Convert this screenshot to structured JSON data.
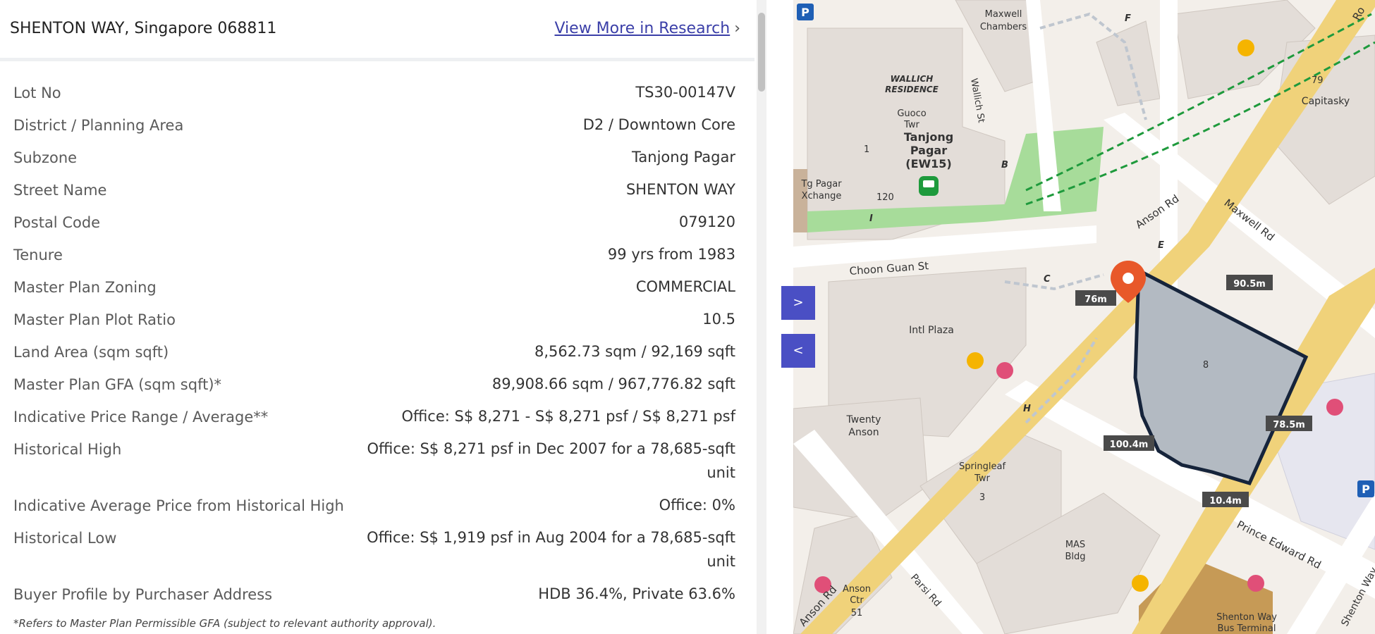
{
  "header": {
    "address": "SHENTON WAY, Singapore 068811",
    "view_more": "View More in Research"
  },
  "rows": [
    {
      "label": "Lot No",
      "value": "TS30-00147V"
    },
    {
      "label": "District / Planning Area",
      "value": "D2 / Downtown Core"
    },
    {
      "label": "Subzone",
      "value": "Tanjong Pagar"
    },
    {
      "label": "Street Name",
      "value": "SHENTON WAY"
    },
    {
      "label": "Postal Code",
      "value": "079120"
    },
    {
      "label": "Tenure",
      "value": "99 yrs from 1983"
    },
    {
      "label": "Master Plan Zoning",
      "value": "COMMERCIAL"
    },
    {
      "label": "Master Plan Plot Ratio",
      "value": "10.5"
    },
    {
      "label": "Land Area (sqm sqft)",
      "value": "8,562.73 sqm / 92,169 sqft"
    },
    {
      "label": "Master Plan GFA (sqm sqft)*",
      "value": "89,908.66 sqm / 967,776.82 sqft"
    },
    {
      "label": "Indicative Price Range / Average**",
      "value": "Office: S$ 8,271 - S$ 8,271 psf / S$ 8,271 psf"
    },
    {
      "label": "Historical High",
      "value_line1": "Office: S$ 8,271 psf in Dec 2007 for a 78,685-sqft",
      "value_line2": "unit"
    },
    {
      "label": "Indicative Average Price from Historical High",
      "value": "Office: 0%"
    },
    {
      "label": "Historical Low",
      "value_line1": "Office: S$ 1,919 psf in Aug 2004 for a 78,685-sqft",
      "value_line2": "unit"
    },
    {
      "label": "Buyer Profile by Purchaser Address",
      "value": "HDB 36.4%, Private 63.6%"
    }
  ],
  "footnote": "*Refers to Master Plan Permissible GFA (subject to relevant authority approval).",
  "nav": {
    "expand": ">",
    "collapse": "<"
  },
  "map": {
    "labels": {
      "maxwell_chambers_1": "Maxwell",
      "maxwell_chambers_2": "Chambers",
      "wallich_1": "WALLICH",
      "wallich_2": "RESIDENCE",
      "wallich_st": "Wallich St",
      "guoco_1": "Guoco",
      "guoco_2": "Twr",
      "tp_1": "Tanjong",
      "tp_2": "Pagar",
      "tp_3": "(EW15)",
      "tgx_1": "Tg Pagar",
      "tgx_2": "Xchange",
      "num_1": "1",
      "num_120": "120",
      "num_79": "79",
      "num_8": "8",
      "num_3": "3",
      "num_51": "51",
      "capitasky": "Capitasky",
      "choon_guan": "Choon Guan St",
      "anson_rd_top": "Anson Rd",
      "anson_rd_bottom": "Anson Rd",
      "maxwell_rd": "Maxwell Rd",
      "intl_plaza": "Intl Plaza",
      "twenty_anson_1": "Twenty",
      "twenty_anson_2": "Anson",
      "springleaf_1": "Springleaf",
      "springleaf_2": "Twr",
      "mas_1": "MAS",
      "mas_2": "Bldg",
      "anson_ctr_1": "Anson",
      "anson_ctr_2": "Ctr",
      "parsi_rd": "Parsi Rd",
      "prince_edward": "Prince Edward Rd",
      "shenton_term_1": "Shenton Way",
      "shenton_term_2": "Bus Terminal",
      "shenton_way": "Shenton Way",
      "robinson": "Ro",
      "exit_b": "B",
      "exit_c": "C",
      "exit_e": "E",
      "exit_f": "F",
      "exit_h": "H",
      "exit_i": "I",
      "parking_p": "P"
    },
    "measurements": {
      "m1": "76m",
      "m2": "90.5m",
      "m3": "78.5m",
      "m4": "100.4m",
      "m5": "10.4m"
    },
    "colors": {
      "road_major": "#f0d27a",
      "park": "#a7dc9a",
      "building": "#e3ddd8",
      "plot_fill": "#b3bac2",
      "plot_stroke": "#16243b",
      "mrt_line": "#1e9a3c",
      "marker": "#e8582a",
      "nav_button": "#4a4fc4",
      "link": "#3b3fa8"
    }
  }
}
